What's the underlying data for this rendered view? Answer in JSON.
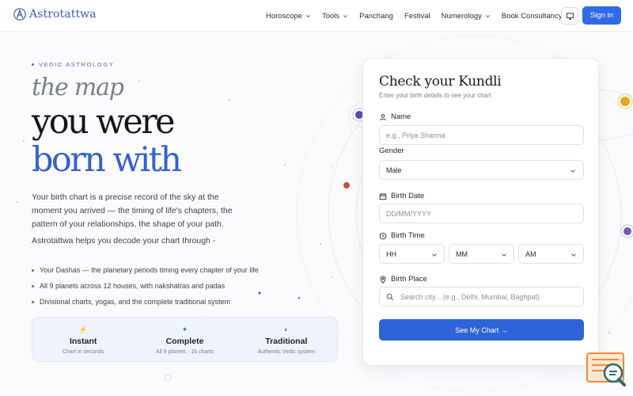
{
  "header": {
    "brand": "Astrotattwa",
    "nav": [
      {
        "label": "Horoscope",
        "has_dropdown": true
      },
      {
        "label": "Tools",
        "has_dropdown": true
      },
      {
        "label": "Panchang",
        "has_dropdown": false
      },
      {
        "label": "Festival",
        "has_dropdown": false
      },
      {
        "label": "Numerology",
        "has_dropdown": true
      },
      {
        "label": "Book Consultancy",
        "has_dropdown": false
      }
    ],
    "display_icon": "monitor-icon",
    "signin_label": "Sign in"
  },
  "hero": {
    "eyebrow": "VEDIC ASTROLOGY",
    "headline_1": "the map",
    "headline_2": "you were",
    "headline_3": "born with",
    "intro": "Your birth chart is a precise record of the sky at the moment you arrived — the timing of life's chapters, the pattern of your relationships, the shape of your path.",
    "intro_2": "Astrotattwa helps you decode your chart through -",
    "bullets": [
      "Your Dashas — the planetary periods timing every chapter of your life",
      "All 9 planets across 12 houses, with nakshatras and padas",
      "Divisional charts, yogas, and the complete traditional system"
    ],
    "stats": [
      {
        "icon": "⚡",
        "title": "Instant",
        "subtitle": "Chart in seconds"
      },
      {
        "icon": "✦",
        "title": "Complete",
        "subtitle": "All 9 planets · 16 charts"
      },
      {
        "icon": "◐",
        "title": "Traditional",
        "subtitle": "Authentic Vedic system"
      }
    ]
  },
  "form": {
    "title": "Check your Kundli",
    "subtitle": "Enter your birth details to see your chart",
    "name_label": "Name",
    "name_placeholder": "e.g., Priya Sharma",
    "gender_label": "Gender",
    "gender_value": "Male",
    "date_label": "Birth Date",
    "date_placeholder": "DD/MM/YYYY",
    "time_label": "Birth Time",
    "hour_value": "HH",
    "minute_value": "MM",
    "ampm_value": "AM",
    "place_label": "Birth Place",
    "place_placeholder": "Search city... (e.g., Delhi, Mumbai, Baghpat)",
    "submit_label": "See My Chart →"
  },
  "colors": {
    "accent": "#2f6be6",
    "brand": "#3b5cae",
    "headline_blue": "#3560cf",
    "chat_widget": "#f08a3c"
  }
}
